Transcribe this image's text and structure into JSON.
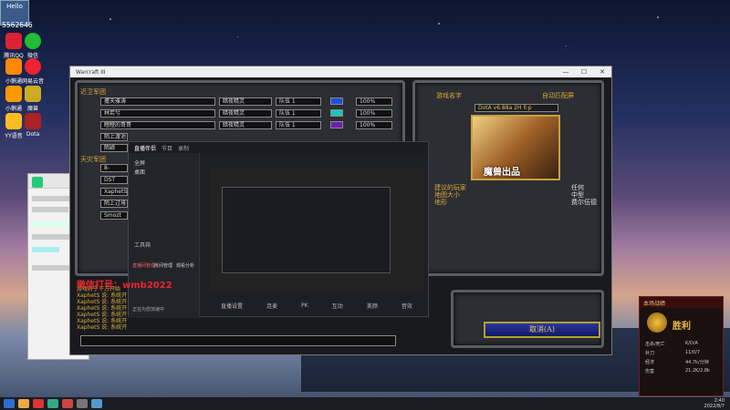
{
  "desktop": {
    "badge_label": "Hello",
    "counter": "5562646",
    "icons": [
      {
        "label": "腾讯QQ",
        "color": "#d23"
      },
      {
        "label": "微信",
        "color": "#2b3"
      },
      {
        "label": "小鹅通",
        "color": "#f80"
      },
      {
        "label": "网易云音乐",
        "color": "#e23"
      },
      {
        "label": "小鹅通",
        "color": "#f90"
      },
      {
        "label": "魔兽",
        "color": "#ca2"
      },
      {
        "label": "YY语音",
        "color": "#fb2"
      },
      {
        "label": "Dota",
        "color": "#a22"
      }
    ]
  },
  "chat_window": {
    "tag_text": "微信打号：wmb2022"
  },
  "game_window": {
    "title": "Warcraft III",
    "controls": [
      "—",
      "☐",
      "✕"
    ],
    "left_panel_title": "近卫军团",
    "scourge_title": "天灾军团",
    "slots_top": [
      {
        "name": "攫天雅涛",
        "mode": "暗夜精灵",
        "team": "队伍 1",
        "color": "#1f4fe0",
        "pct": "100%"
      },
      {
        "name": "林若兮",
        "mode": "暗夜精灵",
        "team": "队伍 1",
        "color": "#1ec8b8",
        "pct": "100%"
      },
      {
        "name": "瞪瞪的哥哥",
        "mode": "暗夜精灵",
        "team": "队伍 1",
        "color": "#6a1fb0",
        "pct": "100%"
      },
      {
        "name": "陌上渡池",
        "mode": "",
        "team": "",
        "color": "",
        "pct": ""
      },
      {
        "name": "陌颖",
        "mode": "",
        "team": "",
        "color": "",
        "pct": ""
      }
    ],
    "slots_bottom": [
      "8-",
      "DST",
      "XaphetS",
      "陌上过境",
      "Smozt"
    ],
    "map_panel_title": "游戏名字",
    "auto_match": "自动匹配屏",
    "map_name": "DotA v6.88a 2H ll:p",
    "map_art_text": "魔兽出品",
    "map_info_left": "建议的玩家\n地图大小\n地形",
    "map_info_right": "任何\n中型\n费尔伍德",
    "cancel_button": "取消(A)",
    "log_lines": [
      "游戏将于下方开始",
      "XaphetS 说: 系统开",
      "XaphetS 说: 系统开",
      "XaphetS 说: 系统开",
      "XaphetS 说: 系统开",
      "XaphetS 说: 系统开",
      "XaphetS 说: 系统开"
    ],
    "watermark": "微信打号：wmb2022"
  },
  "obs_window": {
    "logo": "直播伴侣",
    "tabs": [
      "节目",
      "录制"
    ],
    "scene_items": [
      "全屏",
      "桌面"
    ],
    "side_bottom_label": "工具箱",
    "side_tools": [
      "直播间管理",
      "房间管理",
      "观看分析"
    ],
    "bottom_tools": [
      "直播设置",
      "连麦",
      "PK",
      "互动",
      "美颜",
      "音效"
    ],
    "status_line": "正在为您加速中"
  },
  "victory_popup": {
    "header": "本场战绩",
    "word": "胜利",
    "stats": [
      {
        "k": "击杀/死亡",
        "v": "K/D/A"
      },
      {
        "k": "补刀",
        "v": "11/0/7"
      },
      {
        "k": "经济",
        "v": "44.7k/分钟"
      },
      {
        "k": "伤害",
        "v": "21.2K/2.8k"
      }
    ]
  },
  "taskbar": {
    "items_colors": [
      "#2b6fd0",
      "#ea4",
      "#d33",
      "#3a8",
      "#c44",
      "#777",
      "#59c"
    ],
    "tray_time": "2:40",
    "tray_date": "2022/8/7"
  }
}
